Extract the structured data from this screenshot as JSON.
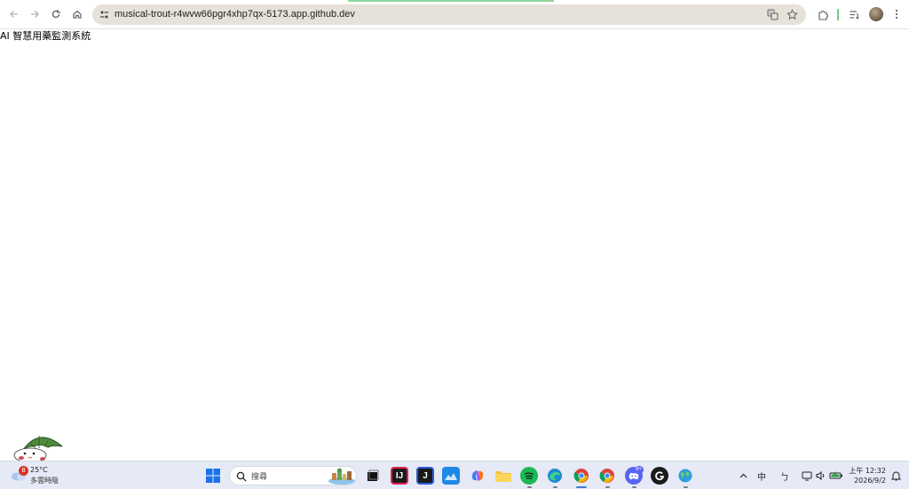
{
  "browser": {
    "url": "musical-trout-r4wvw66pgr4xhp7qx-5173.app.github.dev",
    "nav": {
      "back_icon": "back-arrow-icon",
      "forward_icon": "forward-arrow-icon",
      "reload_icon": "reload-icon",
      "home_icon": "home-icon"
    },
    "toolbar_icons": [
      "translate-icon",
      "bookmark-star-icon",
      "extensions-icon",
      "reading-list-icon",
      "profile-avatar",
      "menu-icon"
    ]
  },
  "page": {
    "title": "AI 智慧用藥監測系統"
  },
  "taskbar": {
    "weather": {
      "badge": "8",
      "temp": "25°C",
      "condition": "多雲時陰"
    },
    "search": {
      "placeholder": "搜尋"
    },
    "apps": [
      {
        "name": "task-view",
        "color": "#1f1f1f"
      },
      {
        "name": "intellij-idea",
        "color": "#e0224f"
      },
      {
        "name": "jetbrains",
        "color": "#2a5cd6"
      },
      {
        "name": "photos",
        "color": "#1e88e5"
      },
      {
        "name": "copilot",
        "color": "#7f57f5"
      },
      {
        "name": "file-explorer",
        "color": "#f6c344"
      },
      {
        "name": "spotify",
        "color": "#1db954"
      },
      {
        "name": "edge",
        "color": "#1b8ad4"
      },
      {
        "name": "chrome-active",
        "color": "#db4437"
      },
      {
        "name": "chrome",
        "color": "#db4437"
      },
      {
        "name": "discord",
        "color": "#5865f2"
      },
      {
        "name": "github-app",
        "color": "#1b1b1b"
      },
      {
        "name": "globe-app",
        "color": "#2f9be0"
      }
    ],
    "discord_badge": "9+",
    "tray": {
      "ime": "中",
      "ime2": "ㄅ"
    },
    "clock": {
      "time": "上午 12:32",
      "date": "2026/9/2"
    }
  }
}
